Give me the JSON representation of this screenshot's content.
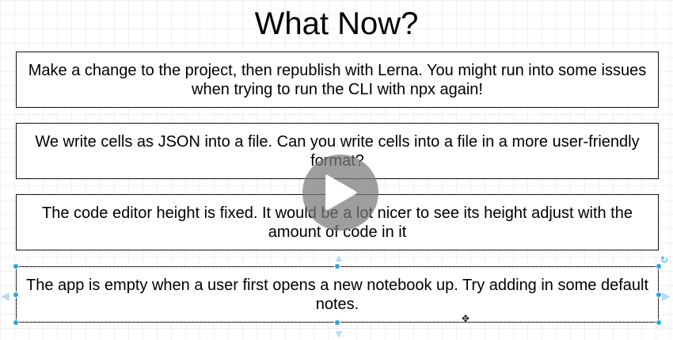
{
  "slide": {
    "title": "What Now?",
    "cards": [
      "Make a change to the project, then republish with Lerna. You might run into some issues when trying to run the CLI with npx again!",
      "We write cells as JSON into a file. Can you write cells into a file in a more user-friendly format?",
      "The code editor height is fixed. It would be a lot nicer to see its height adjust with the amount of code in it",
      "The app is empty when a user first opens a new notebook up. Try adding in some default notes."
    ]
  },
  "colors": {
    "handle": "#29a3e6",
    "grid": "#eef0f3",
    "play_overlay": "#787878"
  },
  "icons": {
    "play": "play-icon",
    "rotate": "rotate-handle-icon",
    "move_cursor": "move-cursor-icon"
  }
}
